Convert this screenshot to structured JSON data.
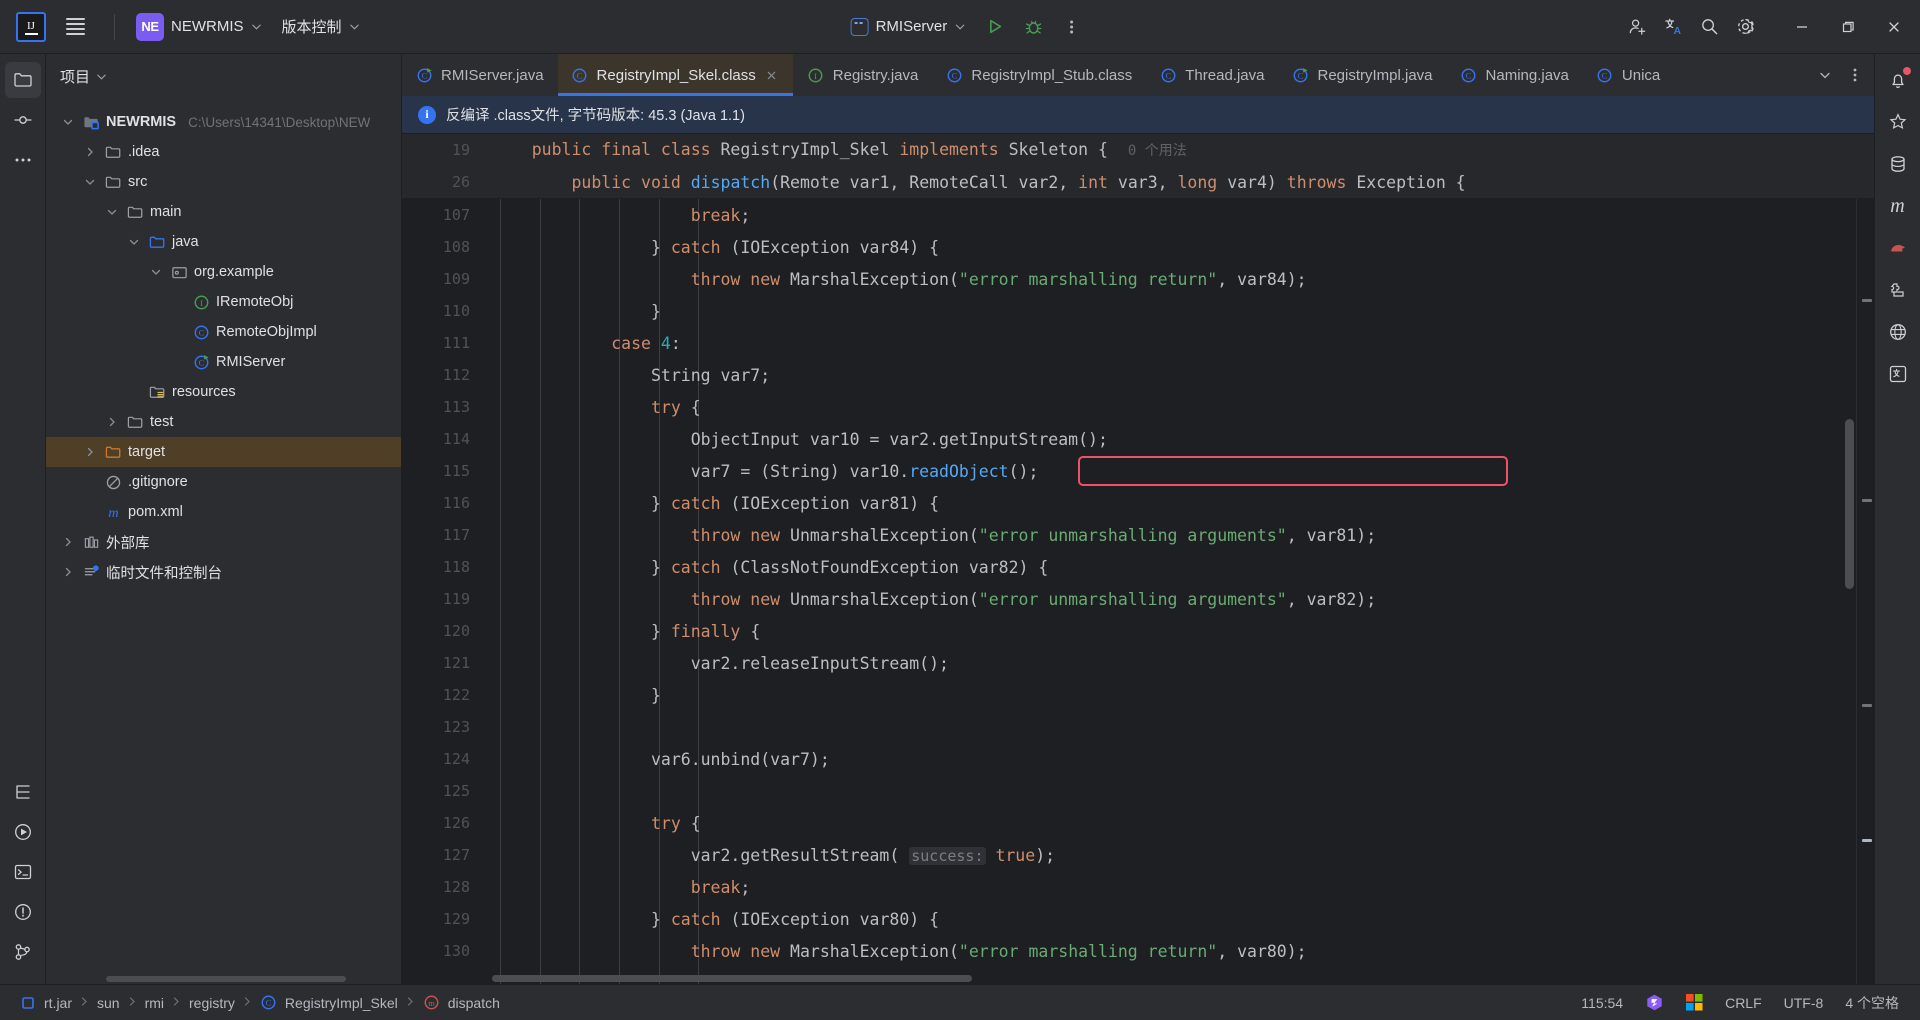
{
  "titlebar": {
    "logo_text": "IJ",
    "project_badge": "NE",
    "project_name": "NEWRMIS",
    "vcs_label": "版本控制",
    "run_config": "RMIServer",
    "icons": {
      "menu": "hamburger-icon",
      "run": "run-icon",
      "debug": "debug-icon",
      "more": "more-vertical-icon",
      "share": "add-user-icon",
      "translate": "translate-icon",
      "search": "search-icon",
      "settings": "gear-icon",
      "minimize": "minimize-icon",
      "maximize": "restore-icon",
      "close": "close-icon"
    }
  },
  "activity_bar_left": [
    {
      "name": "project-tool-icon",
      "glyph": "folder"
    },
    {
      "name": "commit-tool-icon",
      "glyph": "commit"
    },
    {
      "name": "more-tool-icon",
      "glyph": "dots"
    },
    {
      "name": "structure-tool-icon",
      "glyph": "structure"
    },
    {
      "name": "run-tool-icon",
      "glyph": "play"
    },
    {
      "name": "terminal-tool-icon",
      "glyph": "terminal"
    },
    {
      "name": "problems-tool-icon",
      "glyph": "warning"
    },
    {
      "name": "git-tool-icon",
      "glyph": "git"
    }
  ],
  "activity_bar_right": [
    {
      "name": "notifications-icon",
      "glyph": "bell",
      "badge": true
    },
    {
      "name": "ai-assistant-icon",
      "glyph": "ai"
    },
    {
      "name": "database-icon",
      "glyph": "db"
    },
    {
      "name": "maven-icon",
      "glyph": "m"
    },
    {
      "name": "gradle-icon",
      "glyph": "elephant"
    },
    {
      "name": "plugins-icon",
      "glyph": "plug"
    },
    {
      "name": "web-icon",
      "glyph": "globe"
    },
    {
      "name": "translation-icon",
      "glyph": "translate"
    }
  ],
  "project_panel": {
    "title": "项目",
    "tree": [
      {
        "depth": 0,
        "arrow": "down",
        "icon": "module",
        "label": "NEWRMIS",
        "path": "C:\\Users\\14341\\Desktop\\NEW",
        "bold": true,
        "selected": false
      },
      {
        "depth": 1,
        "arrow": "right",
        "icon": "folder",
        "label": ".idea",
        "path": "",
        "bold": false,
        "selected": false
      },
      {
        "depth": 1,
        "arrow": "down",
        "icon": "folder",
        "label": "src",
        "path": "",
        "bold": false,
        "selected": false
      },
      {
        "depth": 2,
        "arrow": "down",
        "icon": "folder",
        "label": "main",
        "path": "",
        "bold": false,
        "selected": false
      },
      {
        "depth": 3,
        "arrow": "down",
        "icon": "folder-src",
        "label": "java",
        "path": "",
        "bold": false,
        "selected": false
      },
      {
        "depth": 4,
        "arrow": "down",
        "icon": "package",
        "label": "org.example",
        "path": "",
        "bold": false,
        "selected": false
      },
      {
        "depth": 5,
        "arrow": "none",
        "icon": "interface",
        "label": "IRemoteObj",
        "path": "",
        "bold": false,
        "selected": false
      },
      {
        "depth": 5,
        "arrow": "none",
        "icon": "class",
        "label": "RemoteObjImpl",
        "path": "",
        "bold": false,
        "selected": false
      },
      {
        "depth": 5,
        "arrow": "none",
        "icon": "class-run",
        "label": "RMIServer",
        "path": "",
        "bold": false,
        "selected": false
      },
      {
        "depth": 3,
        "arrow": "none",
        "icon": "folder-res",
        "label": "resources",
        "path": "",
        "bold": false,
        "selected": false
      },
      {
        "depth": 2,
        "arrow": "right",
        "icon": "folder",
        "label": "test",
        "path": "",
        "bold": false,
        "selected": false
      },
      {
        "depth": 1,
        "arrow": "right",
        "icon": "folder-target",
        "label": "target",
        "path": "",
        "bold": false,
        "selected": true
      },
      {
        "depth": 1,
        "arrow": "none",
        "icon": "gitignore",
        "label": ".gitignore",
        "path": "",
        "bold": false,
        "selected": false
      },
      {
        "depth": 1,
        "arrow": "none",
        "icon": "maven",
        "label": "pom.xml",
        "path": "",
        "bold": false,
        "selected": false
      },
      {
        "depth": 0,
        "arrow": "right",
        "icon": "library",
        "label": "外部库",
        "path": "",
        "bold": false,
        "selected": false
      },
      {
        "depth": 0,
        "arrow": "right",
        "icon": "scratch",
        "label": "临时文件和控制台",
        "path": "",
        "bold": false,
        "selected": false
      }
    ]
  },
  "tabs": [
    {
      "label": "RMIServer.java",
      "icon": "class-run",
      "active": false,
      "closable": false
    },
    {
      "label": "RegistryImpl_Skel.class",
      "icon": "class",
      "active": true,
      "closable": true
    },
    {
      "label": "Registry.java",
      "icon": "interface",
      "active": false,
      "closable": false
    },
    {
      "label": "RegistryImpl_Stub.class",
      "icon": "class",
      "active": false,
      "closable": false
    },
    {
      "label": "Thread.java",
      "icon": "class",
      "active": false,
      "closable": false
    },
    {
      "label": "RegistryImpl.java",
      "icon": "class-run",
      "active": false,
      "closable": false
    },
    {
      "label": "Naming.java",
      "icon": "class",
      "active": false,
      "closable": false
    },
    {
      "label": "Unica",
      "icon": "class",
      "active": false,
      "closable": false
    }
  ],
  "notification": {
    "icon": "info-icon",
    "text": "反编译 .class文件, 字节码版本: 45.3 (Java 1.1)"
  },
  "sticky_header": [
    {
      "line": "19",
      "html": "    <span class=\"kw\">public final class</span> <span class=\"pl\">RegistryImpl_Skel</span> <span class=\"kw\">implements</span> <span class=\"pl\">Skeleton</span> <span class=\"pl\">{</span>  <span class=\"hint\">0 个用法</span>"
    },
    {
      "line": "26",
      "html": "        <span class=\"kw\">public void</span> <span class=\"fn\">dispatch</span><span class=\"pl\">(Remote var1, RemoteCall var2,</span> <span class=\"kw\">int</span> <span class=\"pl\">var3,</span> <span class=\"kw\">long</span> <span class=\"pl\">var4)</span> <span class=\"kw\">throws</span> <span class=\"pl\">Exception {</span>"
    }
  ],
  "code_lines": [
    {
      "line": "107",
      "html": "                    <span class=\"kw\">break</span><span class=\"pl\">;</span>"
    },
    {
      "line": "108",
      "html": "                <span class=\"pl\">}</span> <span class=\"kw\">catch</span> <span class=\"pl\">(IOException var84) {</span>"
    },
    {
      "line": "109",
      "html": "                    <span class=\"kw\">throw new</span> <span class=\"pl\">MarshalException(</span><span class=\"str\">\"error marshalling return\"</span><span class=\"pl\">, var84);</span>"
    },
    {
      "line": "110",
      "html": "                <span class=\"pl\">}</span>"
    },
    {
      "line": "111",
      "html": "            <span class=\"kw\">case</span> <span class=\"num\">4</span><span class=\"pl\">:</span>"
    },
    {
      "line": "112",
      "html": "                <span class=\"pl\">String var7;</span>"
    },
    {
      "line": "113",
      "html": "                <span class=\"kw\">try</span> <span class=\"pl\">{</span>"
    },
    {
      "line": "114",
      "html": "                    <span class=\"pl\">ObjectInput var10 = var2.getInputStream();</span>"
    },
    {
      "line": "115",
      "html": "                    <span class=\"pl\">var7 = (String) var10.</span><span class=\"fn\">readObject</span><span class=\"pl\">();</span>",
      "highlight": true
    },
    {
      "line": "116",
      "html": "                <span class=\"pl\">}</span> <span class=\"kw\">catch</span> <span class=\"pl\">(IOException var81) {</span>"
    },
    {
      "line": "117",
      "html": "                    <span class=\"kw\">throw new</span> <span class=\"pl\">UnmarshalException(</span><span class=\"str\">\"error unmarshalling arguments\"</span><span class=\"pl\">, var81);</span>"
    },
    {
      "line": "118",
      "html": "                <span class=\"pl\">}</span> <span class=\"kw\">catch</span> <span class=\"pl\">(ClassNotFoundException var82) {</span>"
    },
    {
      "line": "119",
      "html": "                    <span class=\"kw\">throw new</span> <span class=\"pl\">UnmarshalException(</span><span class=\"str\">\"error unmarshalling arguments\"</span><span class=\"pl\">, var82);</span>"
    },
    {
      "line": "120",
      "html": "                <span class=\"pl\">}</span> <span class=\"kw\">finally</span> <span class=\"pl\">{</span>"
    },
    {
      "line": "121",
      "html": "                    <span class=\"pl\">var2.releaseInputStream();</span>"
    },
    {
      "line": "122",
      "html": "                <span class=\"pl\">}</span>"
    },
    {
      "line": "123",
      "html": ""
    },
    {
      "line": "124",
      "html": "                <span class=\"pl\">var6.unbind(var7);</span>"
    },
    {
      "line": "125",
      "html": ""
    },
    {
      "line": "126",
      "html": "                <span class=\"kw\">try</span> <span class=\"pl\">{</span>"
    },
    {
      "line": "127",
      "html": "                    <span class=\"pl\">var2.getResultStream(</span> <span class=\"param-hint\">success:</span> <span class=\"kw\">true</span><span class=\"pl\">);</span>"
    },
    {
      "line": "128",
      "html": "                    <span class=\"kw\">break</span><span class=\"pl\">;</span>"
    },
    {
      "line": "129",
      "html": "                <span class=\"pl\">}</span> <span class=\"kw\">catch</span> <span class=\"pl\">(IOException var80) {</span>"
    },
    {
      "line": "130",
      "html": "                    <span class=\"kw\">throw new</span> <span class=\"pl\">MarshalException(</span><span class=\"str\">\"error marshalling return\"</span><span class=\"pl\">, var80);</span>"
    }
  ],
  "statusbar": {
    "breadcrumb": [
      {
        "label": "rt.jar",
        "icon": "jar-icon"
      },
      {
        "label": "sun",
        "icon": "none"
      },
      {
        "label": "rmi",
        "icon": "none"
      },
      {
        "label": "registry",
        "icon": "none"
      },
      {
        "label": "RegistryImpl_Skel",
        "icon": "class-icon"
      },
      {
        "label": "dispatch",
        "icon": "method-icon"
      }
    ],
    "caret_position": "115:54",
    "line_separator": "CRLF",
    "encoding": "UTF-8",
    "indent": "4 个空格",
    "ide_icon": "ide-logo-icon",
    "os_icon": "windows-icon"
  },
  "colors": {
    "accent": "#3574f0",
    "highlight_box": "#f1506a",
    "tab_active_bg": "#3b352b",
    "selected_row": "#4e3f26",
    "keyword": "#cf8e6d",
    "string": "#6aab73",
    "number": "#2aacb8",
    "method": "#56a8f5"
  }
}
